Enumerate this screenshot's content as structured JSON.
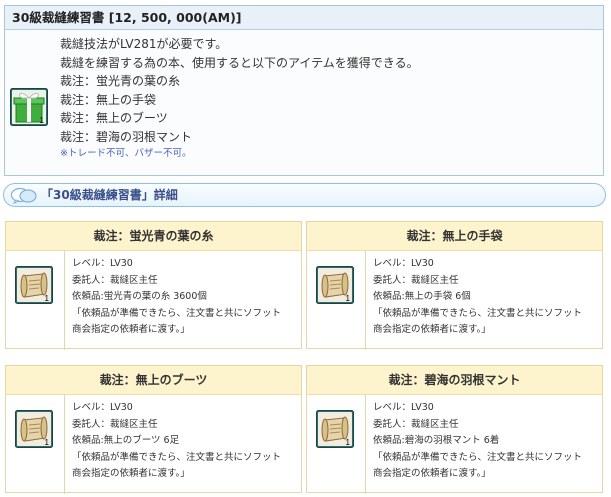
{
  "item": {
    "title": "30級裁縫練習書 [12, 500, 000(AM)]",
    "lines": [
      "裁縫技法がLV281が必要です。",
      "裁縫を練習する為の本、使用すると以下のアイテムを獲得できる。",
      "裁注：蛍光青の葉の糸",
      "裁注：無上の手袋",
      "裁注：無上のブーツ",
      "裁注：碧海の羽根マント"
    ],
    "note": "※トレード不可、バザー不可。",
    "icon": "gift-box-icon",
    "icon_count": "1"
  },
  "section": {
    "title": "「30級裁縫練習書」詳細",
    "icon": "speech-bubble-icon"
  },
  "cards": [
    {
      "title": "裁注：蛍光青の葉の糸",
      "level": "レベル：LV30",
      "client": "委託人：裁縫区主任",
      "request": "依頼品:蛍光青の葉の糸 3600個",
      "desc1": "「依頼品が準備できたら、注文書と共にソフット",
      "desc2": "商会指定の依頼者に渡す。」",
      "icon_count": "1"
    },
    {
      "title": "裁注：無上の手袋",
      "level": "レベル：LV30",
      "client": "委託人：裁縫区主任",
      "request": "依頼品:無上の手袋 6個",
      "desc1": "「依頼品が準備できたら、注文書と共にソフット",
      "desc2": "商会指定の依頼者に渡す。」",
      "icon_count": "1"
    },
    {
      "title": "裁注：無上のブーツ",
      "level": "レベル：LV30",
      "client": "委託人：裁縫区主任",
      "request": "依頼品:無上のブーツ 6足",
      "desc1": "「依頼品が準備できたら、注文書と共にソフット",
      "desc2": "商会指定の依頼者に渡す。」",
      "icon_count": "1"
    },
    {
      "title": "裁注：碧海の羽根マント",
      "level": "レベル：LV30",
      "client": "委託人：裁縫区主任",
      "request": "依頼品:碧海の羽根マント 6着",
      "desc1": "「依頼品が準備できたら、注文書と共にソフット",
      "desc2": "商会指定の依頼者に渡す。」",
      "icon_count": "1"
    }
  ],
  "colors": {
    "item_border": "#a8c7dd",
    "item_title_bg": "#e8f0f8",
    "note_blue": "#4a64c0",
    "section_border": "#8fc0e6",
    "section_text": "#3a4f8a",
    "card_head_bg": "#fdf3cc",
    "card_border": "#e4d6a6"
  }
}
